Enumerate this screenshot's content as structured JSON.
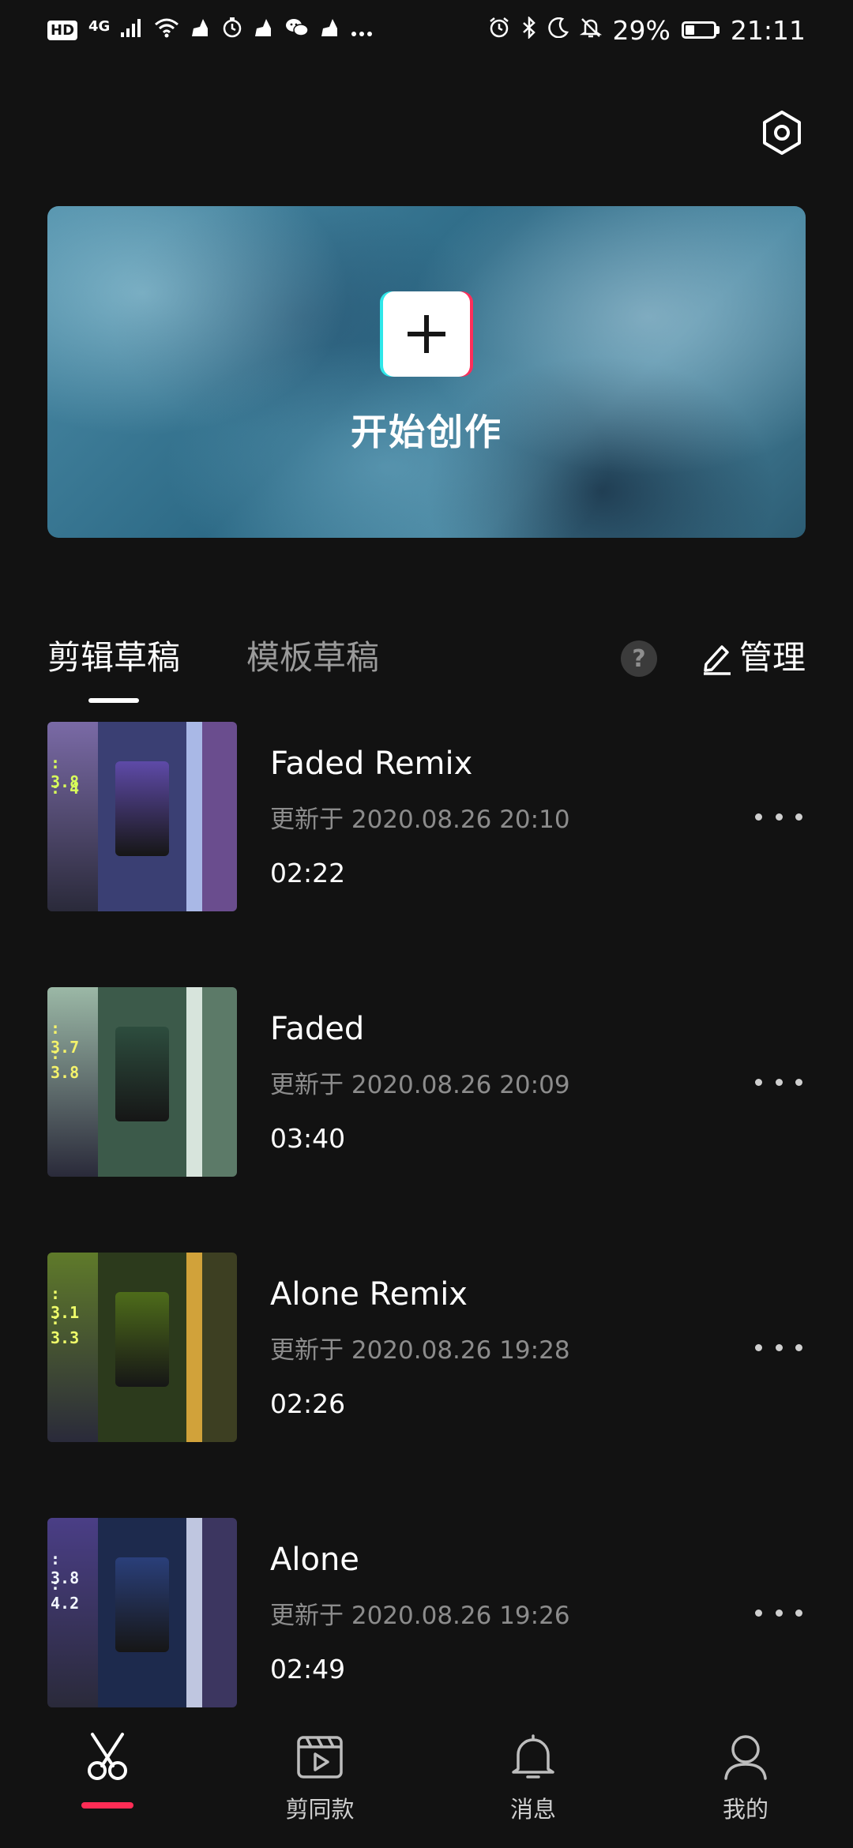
{
  "status_bar": {
    "network_badge_hd": "HD",
    "network_badge_4g": "4G",
    "battery_percent": "29%",
    "time": "21:11",
    "battery_level": 0.29,
    "left_icons": [
      "hd-icon",
      "signal-icon",
      "wifi-icon",
      "cleaner-icon",
      "timer-icon",
      "cleaner-icon",
      "wechat-icon",
      "cleaner-icon",
      "more-notifications-icon"
    ],
    "right_icons": [
      "alarm-icon",
      "bluetooth-icon",
      "moon-icon",
      "mute-icon",
      "battery-icon"
    ]
  },
  "header": {
    "settings_icon": "gear-hexagon-icon"
  },
  "hero": {
    "title": "开始创作",
    "button_icon": "plus-icon"
  },
  "tabs": {
    "items": [
      {
        "label": "剪辑草稿",
        "active": true
      },
      {
        "label": "模板草稿",
        "active": false
      }
    ],
    "help_label": "?",
    "manage_label": "管理",
    "manage_icon": "pencil-icon"
  },
  "drafts": [
    {
      "title": "Faded Remix",
      "updated": "更新于 2020.08.26 20:10",
      "duration": "02:22",
      "thumb": {
        "stat1": ": 3.8",
        "stat2": ": 4",
        "seg_a": "#7a6aa6",
        "seg_b": "#3a3f73",
        "card": "#5e4aa8",
        "seg_c": "#a9b8e6",
        "seg_d": "#6a4d8e",
        "stat_color": "#d8ff5a"
      }
    },
    {
      "title": "Faded",
      "updated": "更新于 2020.08.26 20:09",
      "duration": "03:40",
      "thumb": {
        "stat1": ": 3.7",
        "stat2": ": 3.8",
        "seg_a": "#9bb8a6",
        "seg_b": "#3c5a4a",
        "card": "#2d4d3e",
        "seg_c": "#d7e4dc",
        "seg_d": "#5c7a68",
        "stat_color": "#f4f26b"
      }
    },
    {
      "title": "Alone Remix",
      "updated": "更新于 2020.08.26 19:28",
      "duration": "02:26",
      "thumb": {
        "stat1": ": 3.1",
        "stat2": ": 3.3",
        "seg_a": "#5f7a2a",
        "seg_b": "#2c3a1c",
        "card": "#4e6c1a",
        "seg_c": "#d1a23a",
        "seg_d": "#3d3f22",
        "stat_color": "#f0ff6a"
      }
    },
    {
      "title": "Alone",
      "updated": "更新于 2020.08.26 19:26",
      "duration": "02:49",
      "thumb": {
        "stat1": ": 3.8",
        "stat2": ": 4.2",
        "seg_a": "#4a3e86",
        "seg_b": "#1d2a4d",
        "card": "#2a3f7a",
        "seg_c": "#bfc6e0",
        "seg_d": "#3c3660",
        "stat_color": "#f2f7ff"
      }
    }
  ],
  "bottom_nav": {
    "items": [
      {
        "label": "",
        "icon": "scissors-icon",
        "active": true
      },
      {
        "label": "剪同款",
        "icon": "video-template-icon",
        "active": false
      },
      {
        "label": "消息",
        "icon": "bell-icon",
        "active": false
      },
      {
        "label": "我的",
        "icon": "person-icon",
        "active": false
      }
    ]
  },
  "colors": {
    "background": "#121212",
    "accent": "#fe2c55",
    "secondary_text": "#8c8c8c"
  }
}
